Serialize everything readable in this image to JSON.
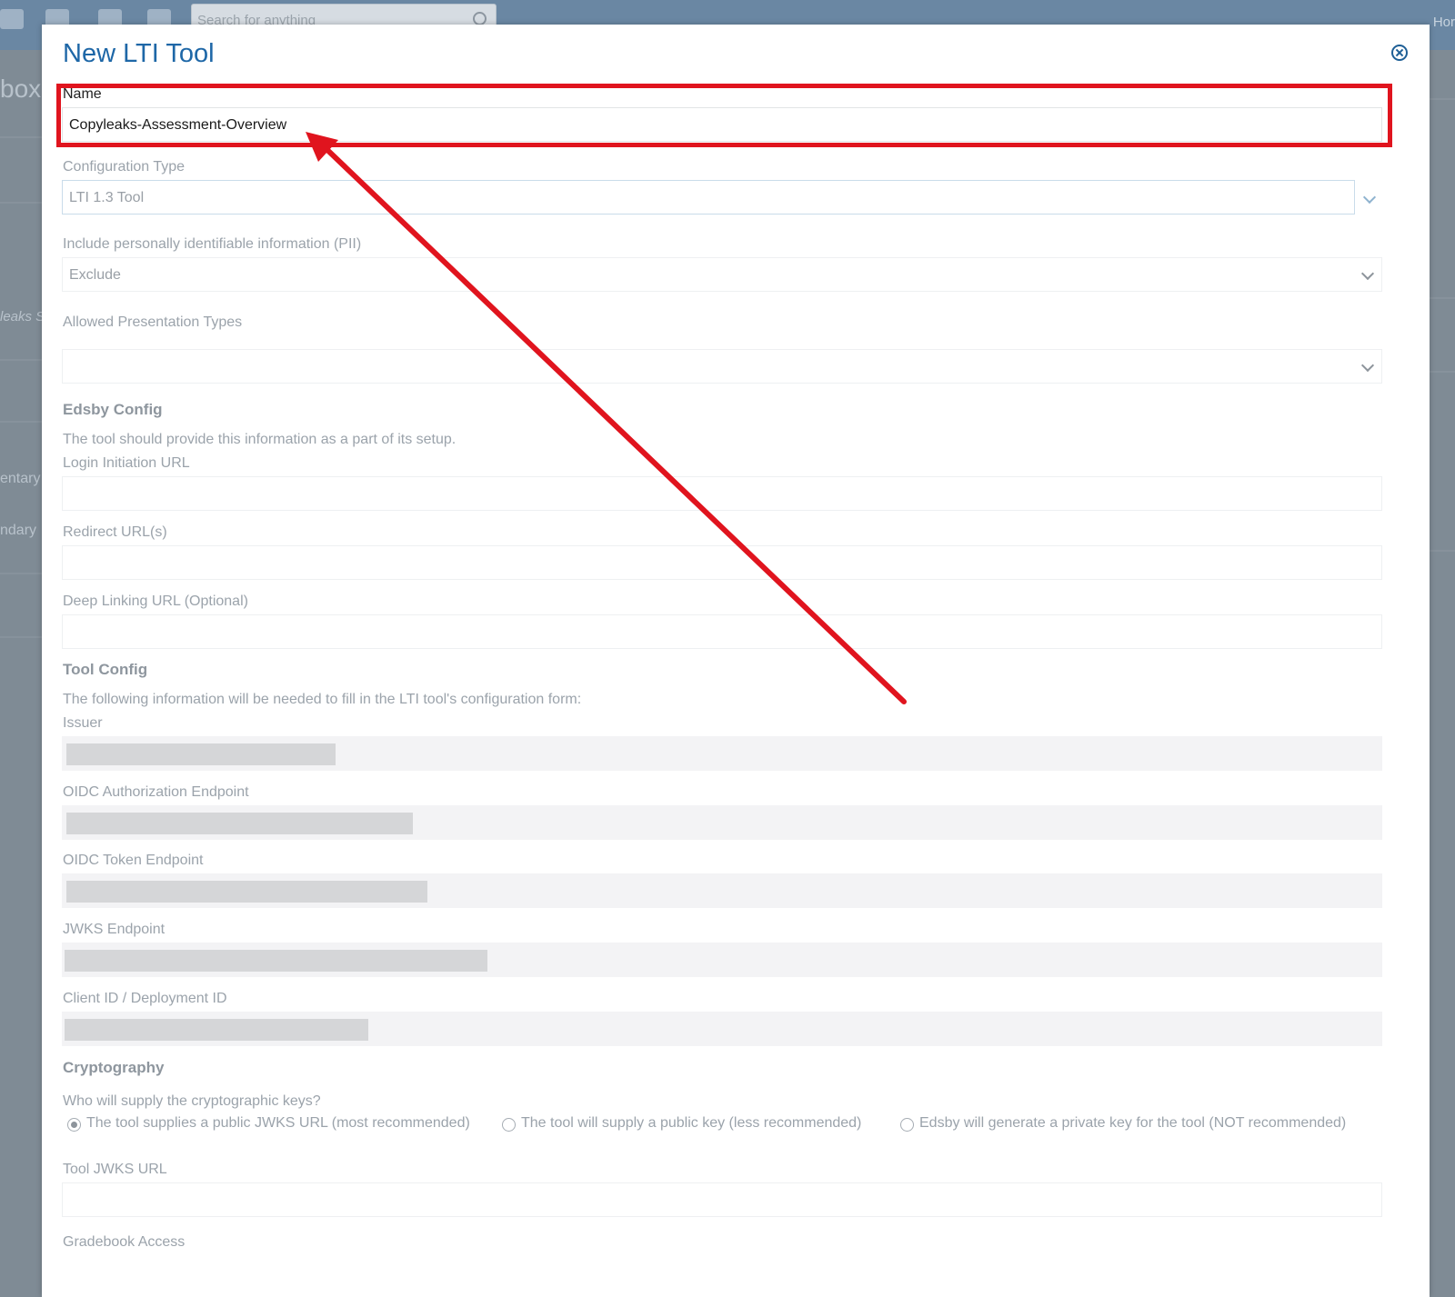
{
  "app": {
    "search_placeholder": "Search for anything",
    "top_right_fragment": "Hor",
    "left_fragments": [
      "box",
      "leaks S",
      "entary",
      "ndary"
    ]
  },
  "modal": {
    "title": "New LTI Tool",
    "close_icon": "close-circle-icon"
  },
  "form": {
    "name": {
      "label": "Name",
      "value": "Copyleaks-Assessment-Overview"
    },
    "config_type": {
      "label": "Configuration Type",
      "value": "LTI 1.3 Tool"
    },
    "pii": {
      "label": "Include personally identifiable information (PII)",
      "value": "Exclude"
    },
    "presentation_types": {
      "label": "Allowed Presentation Types",
      "value": ""
    },
    "edsby_config": {
      "heading": "Edsby Config",
      "description": "The tool should provide this information as a part of its setup.",
      "login_url": {
        "label": "Login Initiation URL",
        "value": ""
      },
      "redirect_urls": {
        "label": "Redirect URL(s)",
        "value": ""
      },
      "deep_linking_url": {
        "label": "Deep Linking URL (Optional)",
        "value": ""
      }
    },
    "tool_config": {
      "heading": "Tool Config",
      "description": "The following information will be needed to fill in the LTI tool's configuration form:",
      "issuer": {
        "label": "Issuer"
      },
      "oidc_auth": {
        "label": "OIDC Authorization Endpoint"
      },
      "oidc_token": {
        "label": "OIDC Token Endpoint"
      },
      "jwks_endpoint": {
        "label": "JWKS Endpoint"
      },
      "client_id": {
        "label": "Client ID / Deployment ID"
      }
    },
    "cryptography": {
      "heading": "Cryptography",
      "question": "Who will supply the cryptographic keys?",
      "options": [
        {
          "label": "The tool supplies a public JWKS URL (most recommended)",
          "checked": true
        },
        {
          "label": "The tool will supply a public key (less recommended)",
          "checked": false
        },
        {
          "label": "Edsby will generate a private key for the tool (NOT recommended)",
          "checked": false
        }
      ],
      "tool_jwks_url": {
        "label": "Tool JWKS URL",
        "value": ""
      }
    },
    "gradebook_access": {
      "label": "Gradebook Access"
    }
  },
  "annotation": {
    "color": "#e0141e",
    "target": "name-field"
  },
  "colors": {
    "title": "#1e67a7",
    "topbar": "#6a87a3",
    "readonly_field": "#f3f3f5"
  }
}
